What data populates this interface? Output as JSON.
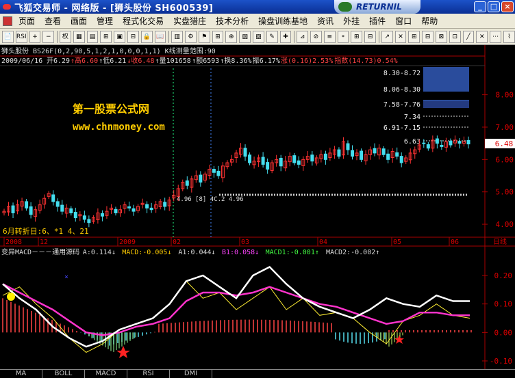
{
  "window": {
    "title": "飞狐交易师 - 网络版 - [狮头股份 SH600539]",
    "brand_label": "RETURNIL",
    "min_label": "_",
    "max_label": "□",
    "close_label": "×"
  },
  "menu": [
    "页面",
    "查看",
    "画面",
    "管理",
    "程式化交易",
    "实盘猎庄",
    "技术分析",
    "操盘训练基地",
    "资讯",
    "外挂",
    "插件",
    "窗口",
    "帮助"
  ],
  "toolbar": {
    "buttons": [
      "📄",
      "RSI",
      "+",
      "−",
      "权",
      "▦",
      "▤",
      "⊞",
      "▣",
      "⊟",
      "🔒",
      "📖",
      "▥",
      "⚙",
      "⚑",
      "⊞",
      "⊕",
      "▧",
      "▨",
      "✎",
      "✚",
      "⊿",
      "⊘",
      "≡",
      "⚬",
      "⊞",
      "⊟",
      "↗",
      "✕",
      "⊞",
      "⊟",
      "⊠",
      "⊡",
      "╱",
      "✕",
      "⋯",
      "⌇"
    ],
    "rsi_label": "RSI"
  },
  "stock": {
    "header_line": "狮头股份 BS26F(0,2,90,5,1,2,1,0,0,0,1,1) K线测量范围:90",
    "date": "2009/06/16",
    "open_label": "开6.29",
    "high_label": "↑高6.60",
    "low_label": "↑低6.21",
    "close_label": "↓收6.48",
    "volume_label": "↑量101658",
    "amount_label": "↑额6593",
    "turnover_label": "↑换8.36%",
    "amplitude_label": "振6.17%",
    "change_label": "涨(0.16)2.53%",
    "index_label": "指数(14.73)0.54%",
    "current_price_tag": "6.48",
    "watermark_name": "第一股票公式网",
    "watermark_url": "www.chnmoney.com",
    "turn_text": "6月转折日:6、*1 4、21",
    "mid_label": "4.96 [8] 4C.2 4.96"
  },
  "price_levels": [
    {
      "label": "8.30-8.72",
      "band": true
    },
    {
      "label": "8.06-8.30",
      "band": true
    },
    {
      "label": "7.58-7.76",
      "band": true
    },
    {
      "label": "7.34",
      "band": false
    },
    {
      "label": "6.91-7.15",
      "band": false
    },
    {
      "label": "6.63",
      "band": false
    }
  ],
  "axes": {
    "price_ticks": [
      "8.00",
      "7.00",
      "6.00",
      "5.00",
      "4.00"
    ],
    "macd_ticks": [
      "0.20",
      "0.10",
      "0.00",
      "-0.10"
    ],
    "time_labels": [
      "2008",
      "12",
      "2009",
      "02",
      "03",
      "04",
      "05",
      "06"
    ],
    "day_axis": "日线"
  },
  "indicator": {
    "title": "变异MACD－－－通用源码",
    "a": "A:0.114↓",
    "macd": "MACD:-0.005↓",
    "a1": "A1:0.044↓",
    "b1": "B1:0.058↓",
    "macd1": "MACD1:-0.001↑",
    "macd2": "MACD2:-0.002↑"
  },
  "tabs": [
    "MA",
    "BOLL",
    "MACD",
    "RSI",
    "DMI"
  ],
  "chart_data": {
    "type": "line",
    "candles_close": [
      4.4,
      4.55,
      4.35,
      4.6,
      4.7,
      4.5,
      4.3,
      4.45,
      4.6,
      4.8,
      4.95,
      4.7,
      4.55,
      4.4,
      4.5,
      4.35,
      4.2,
      4.3,
      4.15,
      4.05,
      4.2,
      4.35,
      4.25,
      4.4,
      4.5,
      4.35,
      4.45,
      4.6,
      4.5,
      4.4,
      4.55,
      4.65,
      4.5,
      4.45,
      4.6,
      4.7,
      4.55,
      4.75,
      4.9,
      5.1,
      5.3,
      5.2,
      5.4,
      5.5,
      5.3,
      5.55,
      5.7,
      5.6,
      5.5,
      5.8,
      5.9,
      6.0,
      6.2,
      6.35,
      6.1,
      5.9,
      5.95,
      6.05,
      5.85,
      5.7,
      5.9,
      6.0,
      5.8,
      5.95,
      6.1,
      5.9,
      5.85,
      6.0,
      6.1,
      5.95,
      6.05,
      6.15,
      6.0,
      6.2,
      6.3,
      6.1,
      6.55,
      6.3,
      6.1,
      6.2,
      6.0,
      6.15,
      6.3,
      6.2,
      6.35,
      6.15,
      6.0,
      6.25,
      6.1,
      5.9,
      6.05,
      6.2,
      6.3,
      6.45,
      6.5,
      6.35,
      6.6,
      6.5,
      6.4,
      6.55,
      6.45,
      6.6,
      6.5,
      6.55,
      6.48
    ],
    "macd_series": {
      "white": [
        0.17,
        0.12,
        0.08,
        0.02,
        -0.02,
        -0.05,
        -0.03,
        0.01,
        0.03,
        0.05,
        0.1,
        0.18,
        0.2,
        0.16,
        0.12,
        0.2,
        0.23,
        0.17,
        0.12,
        0.09,
        0.07,
        0.05,
        0.08,
        0.12,
        0.1,
        0.09,
        0.13,
        0.11,
        0.11
      ],
      "magenta": [
        0.17,
        0.14,
        0.11,
        0.08,
        0.04,
        0.0,
        -0.01,
        0.0,
        0.02,
        0.03,
        0.05,
        0.11,
        0.14,
        0.14,
        0.13,
        0.14,
        0.16,
        0.14,
        0.12,
        0.1,
        0.09,
        0.07,
        0.05,
        0.03,
        0.04,
        0.07,
        0.07,
        0.06,
        0.06
      ],
      "yellow": [
        0.13,
        0.16,
        0.1,
        0.05,
        -0.02,
        -0.07,
        -0.04,
        0.01,
        0.03,
        0.05,
        0.1,
        0.18,
        0.12,
        0.14,
        0.08,
        0.12,
        0.16,
        0.08,
        0.12,
        0.06,
        0.07,
        0.05,
        0.0,
        -0.04,
        0.04,
        0.06,
        0.1,
        0.06,
        0.05
      ]
    },
    "ylim_price": [
      3.6,
      8.9
    ],
    "ylim_macd": [
      -0.1,
      0.26
    ]
  }
}
